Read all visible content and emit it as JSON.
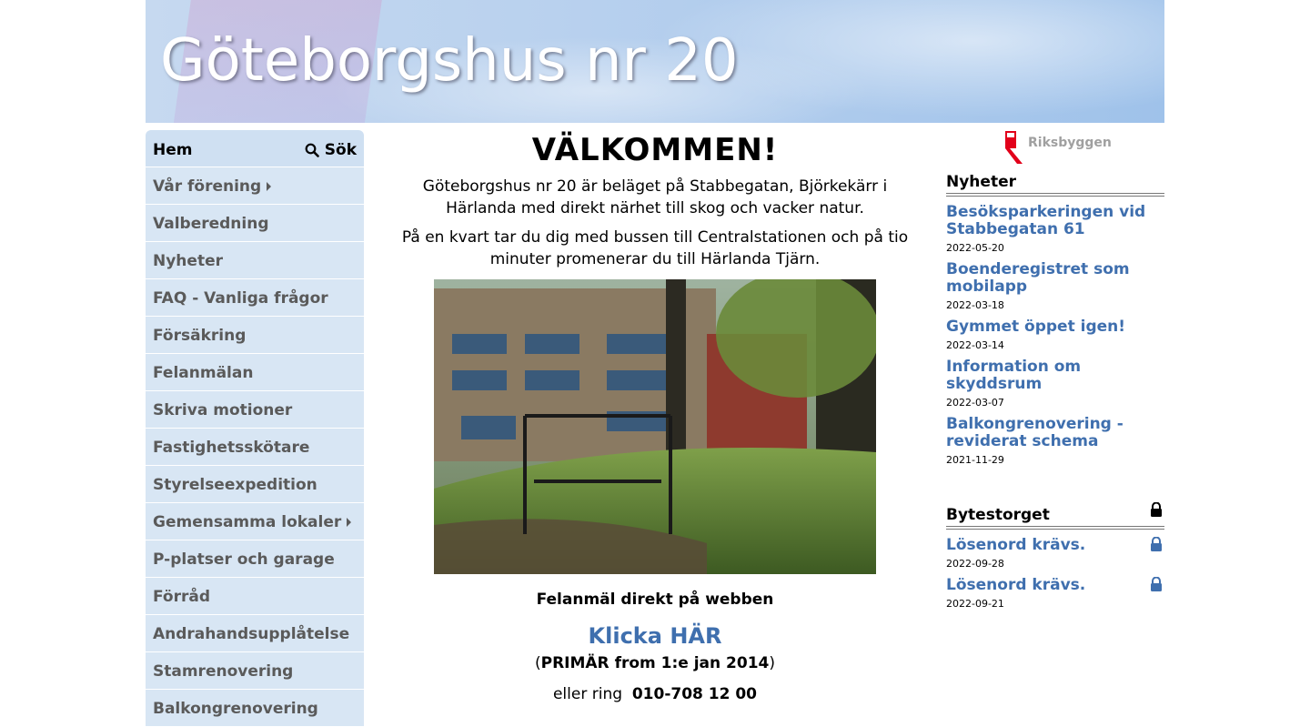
{
  "header": {
    "title": "Göteborgshus nr 20"
  },
  "nav": {
    "home_label": "Hem",
    "search_label": "Sök",
    "items": [
      {
        "label": "Vår förening",
        "has_submenu": true
      },
      {
        "label": "Valberedning",
        "has_submenu": false
      },
      {
        "label": "Nyheter",
        "has_submenu": false
      },
      {
        "label": "FAQ - Vanliga frågor",
        "has_submenu": false
      },
      {
        "label": "Försäkring",
        "has_submenu": false
      },
      {
        "label": "Felanmälan",
        "has_submenu": false
      },
      {
        "label": "Skriva motioner",
        "has_submenu": false
      },
      {
        "label": "Fastighetsskötare",
        "has_submenu": false
      },
      {
        "label": "Styrelseexpedition",
        "has_submenu": false
      },
      {
        "label": "Gemensamma lokaler",
        "has_submenu": true
      },
      {
        "label": "P-platser och garage",
        "has_submenu": false
      },
      {
        "label": "Förråd",
        "has_submenu": false
      },
      {
        "label": "Andrahandsupplåtelse",
        "has_submenu": false
      },
      {
        "label": "Stamrenovering",
        "has_submenu": false
      },
      {
        "label": "Balkongrenovering",
        "has_submenu": false
      }
    ]
  },
  "main": {
    "heading": "VÄLKOMMEN!",
    "paragraph1": "Göteborgshus nr 20 är beläget på Stabbegatan, Björkekärr i Härlanda med direkt närhet till skog och vacker natur.",
    "paragraph2": "På en kvart tar du dig med bussen till Centralstationen och på tio minuter promenerar du till Härlanda Tjärn.",
    "felan_heading": "Felanmäl direkt på webben",
    "klicka_link": "Klicka HÄR",
    "primar_open": "(",
    "primar_bold": "PRIMÄR from 1:e jan 2014",
    "primar_close": ")",
    "ring_prefix": "eller ring",
    "ring_number": "010-708 12 00"
  },
  "right": {
    "logo_text": "Riksbyggen",
    "news_title": "Nyheter",
    "news": [
      {
        "title": "Besöksparkeringen vid Stabbegatan 61",
        "date": "2022-05-20"
      },
      {
        "title": "Boenderegistret som mobilapp",
        "date": "2022-03-18"
      },
      {
        "title": "Gymmet öppet igen!",
        "date": "2022-03-14"
      },
      {
        "title": "Information om skyddsrum",
        "date": "2022-03-07"
      },
      {
        "title": "Balkongrenovering - reviderat schema",
        "date": "2021-11-29"
      }
    ],
    "bytes_title": "Bytestorget",
    "bytes": [
      {
        "title": "Lösenord krävs.",
        "date": "2022-09-28"
      },
      {
        "title": "Lösenord krävs.",
        "date": "2022-09-21"
      }
    ]
  },
  "colors": {
    "link": "#3f6fae",
    "nav_bg": "#d8e6f4",
    "nav_text": "#5a5a5a",
    "brand_red": "#e2001a"
  },
  "icons": {
    "search": "search-icon",
    "lock": "lock-icon",
    "caret": "caret-right-icon"
  }
}
